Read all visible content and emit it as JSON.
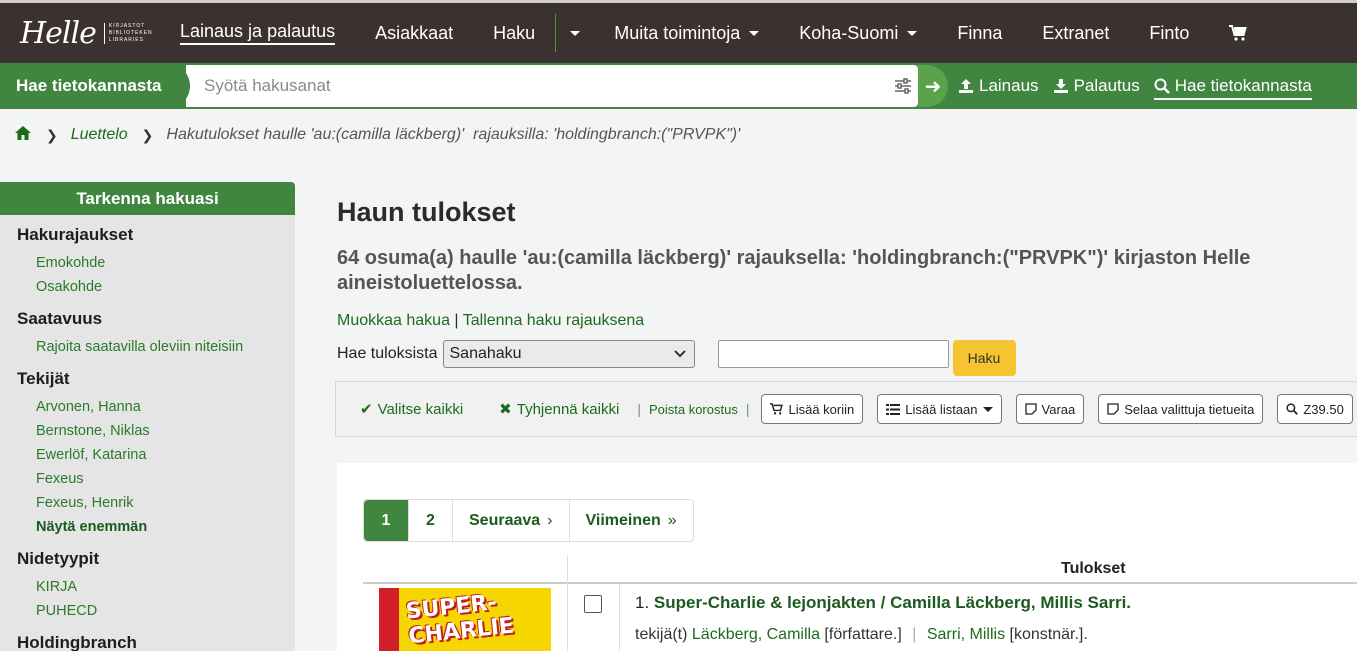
{
  "nav": {
    "logo_text": "Helle",
    "logo_small": "KIRJASTOT BIBLIOTEKEN LIBRARIES",
    "items": [
      {
        "label": "Lainaus ja palautus"
      },
      {
        "label": "Asiakkaat"
      },
      {
        "label": "Haku"
      },
      {
        "label": "Muita toimintoja"
      },
      {
        "label": "Koha-Suomi"
      },
      {
        "label": "Finna"
      },
      {
        "label": "Extranet"
      },
      {
        "label": "Finto"
      }
    ],
    "cart_icon": "cart-icon"
  },
  "searchbar": {
    "label": "Hae tietokannasta",
    "placeholder": "Syötä hakusanat",
    "actions": [
      {
        "label": "Lainaus",
        "icon": "upload-icon"
      },
      {
        "label": "Palautus",
        "icon": "download-icon"
      },
      {
        "label": "Hae tietokannasta",
        "icon": "search-icon"
      }
    ]
  },
  "breadcrumb": {
    "home_icon": "home-icon",
    "link": "Luettelo",
    "current": "Hakutulokset haulle 'au:(camilla läckberg)'  rajauksilla: 'holdingbranch:(\"PRVPK\")'"
  },
  "sidebar": {
    "title": "Tarkenna hakuasi",
    "facets": [
      {
        "title": "Hakurajaukset",
        "items": [
          "Emokohde",
          "Osakohde"
        ]
      },
      {
        "title": "Saatavuus",
        "items": [
          "Rajoita saatavilla oleviin niteisiin"
        ]
      },
      {
        "title": "Tekijät",
        "items": [
          "Arvonen, Hanna",
          "Bernstone, Niklas",
          "Ewerlöf, Katarina",
          "Fexeus",
          "Fexeus, Henrik"
        ],
        "more": "Näytä enemmän"
      },
      {
        "title": "Nidetyypit",
        "items": [
          "KIRJA",
          "PUHECD"
        ]
      },
      {
        "title": "Holdingbranch",
        "items": []
      }
    ]
  },
  "main": {
    "title": "Haun tulokset",
    "summary_line1": "64 osuma(a) haulle 'au:(camilla läckberg)' rajauksella: 'holdingbranch:(\"PRVPK\")' kirjaston Helle",
    "summary_line2": "aineistoluettelossa.",
    "edit_search": "Muokkaa hakua",
    "save_search": "Tallenna haku rajauksena",
    "within_label": "Hae tuloksista",
    "within_select": "Sanahaku",
    "within_button": "Haku"
  },
  "toolbar": {
    "select_all": "Valitse kaikki",
    "clear_all": "Tyhjennä kaikki",
    "remove_highlight": "Poista korostus",
    "add_cart": "Lisää koriin",
    "add_list": "Lisää listaan",
    "hold": "Varaa",
    "browse_selected": "Selaa valittuja tietueita",
    "z3950": "Z39.50"
  },
  "pagination": {
    "pages": [
      "1",
      "2"
    ],
    "next": "Seuraava",
    "last": "Viimeinen"
  },
  "results": {
    "header": "Tulokset",
    "rows": [
      {
        "number": "1.",
        "title": "Super-Charlie & lejonjakten / Camilla Läckberg, Millis Sarri.",
        "cover_text_1": "SUPER-",
        "cover_text_2": "CHARLIE",
        "authors_prefix": "tekijä(t)",
        "author1": "Läckberg, Camilla",
        "role1": "[författare.]",
        "author2": "Sarri, Millis",
        "role2": "[konstnär.]."
      }
    ]
  },
  "colors": {
    "nav_bg": "#3c3131",
    "primary_green": "#408540",
    "link_green": "#1e6a1e",
    "button_yellow": "#f5c430"
  }
}
